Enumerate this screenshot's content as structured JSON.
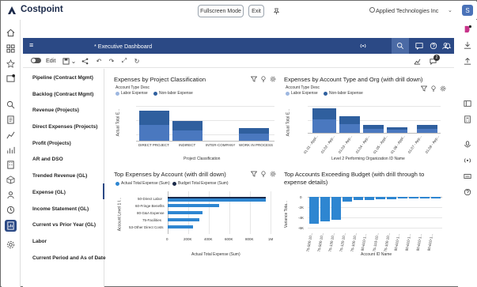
{
  "app": {
    "name": "Costpoint",
    "fullscreen_label": "Fullscreen Mode",
    "exit_label": "Exit",
    "company": "Applied Technologies Inc",
    "user_initial": "S"
  },
  "colors": {
    "brand_dark": "#2b4985",
    "bar_dark": "#2f5f9e",
    "bar_light": "#5b88c8",
    "bar_bright": "#2e86d1",
    "accent_light": "#9db7e0"
  },
  "dashboard": {
    "title": "* Executive Dashboard",
    "edit_label": "Edit",
    "notification_count": "2"
  },
  "nav": {
    "items": [
      "Pipeline (Contract Mgmt)",
      "Backlog (Contract Mgmt)",
      "Revenue (Projects)",
      "Direct Expenses (Projects)",
      "Profit (Projects)",
      "AR and DSO",
      "Trended Revenue (GL)",
      "Expense (GL)",
      "Income Statement (GL)",
      "Current vs Prior Year (GL)",
      "Labor",
      "Current Period and As of Date"
    ],
    "active_index": 7
  },
  "charts": {
    "c1": {
      "title": "Expenses by Project Classification",
      "legend_title": "Account Type Desc",
      "legend": [
        "Labor Expense",
        "Non-labor Expense"
      ],
      "ylabel": "Actual Total E...",
      "xlabel": "Project Classification"
    },
    "c2": {
      "title": "Expenses by Account Type and Org (with drill down)",
      "legend_title": "Account Type Desc",
      "legend": [
        "Labor Expense",
        "Non-labor Expense"
      ],
      "ylabel": "Actual Total E...",
      "xlabel": "Level 2 Performing Organization ID Name"
    },
    "c3": {
      "title": "Top Expenses by Account (with drill down)",
      "legend": [
        "Actual Total Expense (Sum)",
        "Budget Total Expense (Sum)"
      ],
      "ylabel": "Account Level 1 I...",
      "xlabel": "Actual Total Expense (Sum)"
    },
    "c4": {
      "title": "Top Accounts Exceeding Budget (with drill through to",
      "title2": "expense details)",
      "ylabel": "Variance Tota...",
      "xlabel": "Account ID Name"
    }
  },
  "chart_data": [
    {
      "type": "bar",
      "title": "Expenses by Project Classification",
      "categories": [
        "DIRECT PROJECT",
        "INDIRECT",
        "INTER-COMPANY",
        "WORK IN PROCESS"
      ],
      "series": [
        {
          "name": "Labor Expense",
          "values": [
            0.45,
            0.2,
            0.0,
            0.18
          ]
        },
        {
          "name": "Non-labor Expense",
          "values": [
            0.35,
            0.2,
            0.0,
            0.12
          ]
        }
      ],
      "xlabel": "Project Classification",
      "ylabel": "Actual Total E..."
    },
    {
      "type": "bar",
      "title": "Expenses by Account Type and Org (with drill down)",
      "categories": [
        "01.01 - Appl...",
        "01.02 - App...",
        "01.03 - App...",
        "01.04 - App...",
        "01.05 - Appl...",
        "01.06 - Appl...",
        "01.07 - App...",
        "01.08 - App..."
      ],
      "series": [
        {
          "name": "Labor Expense",
          "values": [
            0.35,
            0.2,
            0.08,
            0.05,
            0.05,
            0.03,
            0.07,
            0.06
          ]
        },
        {
          "name": "Non-labor Expense",
          "values": [
            0.25,
            0.15,
            0.09,
            0.05,
            0.05,
            0.04,
            0.08,
            0.06
          ]
        }
      ],
      "xlabel": "Level 2 Performing Organization ID Name",
      "ylabel": "Actual Total E..."
    },
    {
      "type": "bar",
      "title": "Top Expenses by Account (with drill down)",
      "categories": [
        "50-Direct Labor",
        "60-Fringe Benefits",
        "80-G&A Expense",
        "75-Facilities",
        "53-Other Direct Costs"
      ],
      "series": [
        {
          "name": "Actual Total Expense (Sum)",
          "values": [
            1000000,
            500000,
            340000,
            310000,
            250000
          ]
        },
        {
          "name": "Budget Total Expense (Sum)",
          "values": [
            1000000,
            0,
            0,
            0,
            0
          ]
        }
      ],
      "x_ticks": [
        "0",
        "200K",
        "400K",
        "600K",
        "800K",
        "1M"
      ],
      "xlim": [
        0,
        1000000
      ],
      "xlabel": "Actual Total Expense (Sum)",
      "ylabel": "Account Level 1 I..."
    },
    {
      "type": "bar",
      "title": "Top Accounts Exceeding Budget (with drill through to expense details)",
      "categories": [
        "75-500-10...",
        "75-500-10...",
        "75-130-10...",
        "75-120-10...",
        "75-100-10...",
        "80-610-1...",
        "75-110-10...",
        "75-100-10...",
        "80-610-1...",
        "80-610-1...",
        "80-610-1...",
        "80-610-1...",
        "80-610-1...",
        "80-610-1..."
      ],
      "values": [
        -4800,
        -4000,
        -3600,
        -1000,
        -600,
        -500,
        -400,
        -400,
        -300,
        -300,
        -300,
        -300,
        -200,
        -200
      ],
      "y_ticks": [
        "0",
        "-2K",
        "-4K",
        "-6K"
      ],
      "ylim": [
        -6000,
        0
      ],
      "xlabel": "Account ID Name",
      "ylabel": "Variance Tota..."
    }
  ]
}
